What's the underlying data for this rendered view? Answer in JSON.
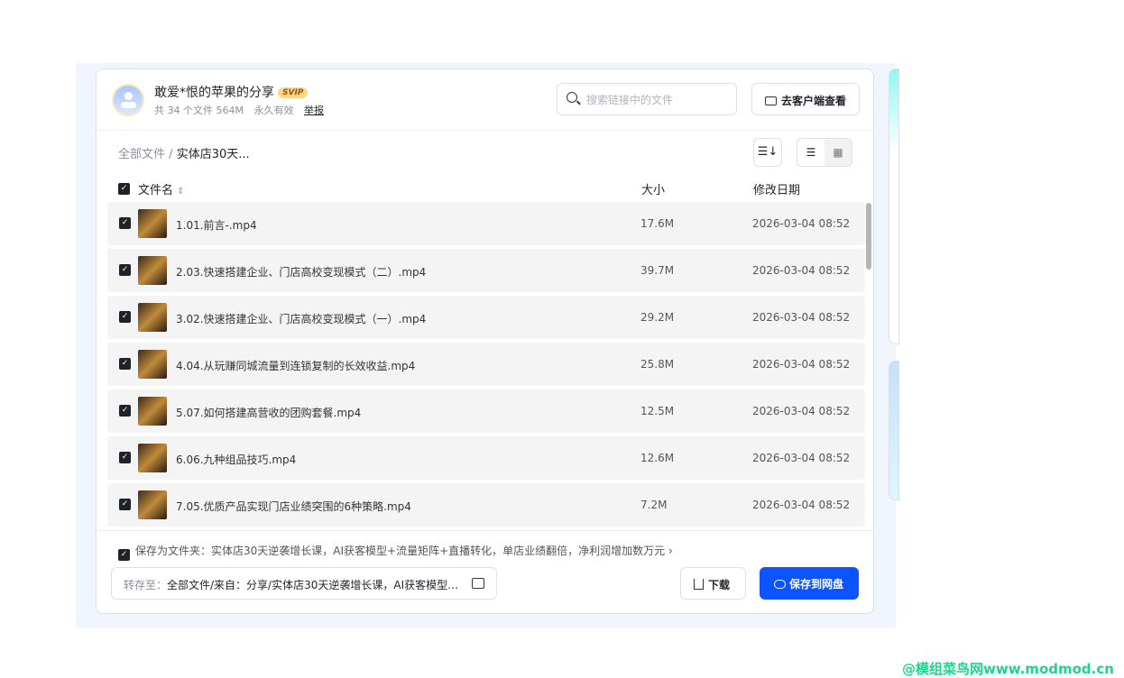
{
  "share": {
    "title": "敢爱*恨的苹果的分享",
    "badge": "SVIP",
    "file_count": "共 34 个文件 564M",
    "validity": "永久有效",
    "report": "举报"
  },
  "search": {
    "placeholder": "搜索链接中的文件"
  },
  "client_button": "去客户端查看",
  "breadcrumb": {
    "root": "全部文件",
    "sep": "/",
    "current": "实体店30天..."
  },
  "table": {
    "headers": {
      "name": "文件名",
      "sort": "⇕",
      "size": "大小",
      "date": "修改日期"
    },
    "rows": [
      {
        "name": "1.01.前言-.mp4",
        "size": "17.6M",
        "date": "2026-03-04 08:52"
      },
      {
        "name": "2.03.快速搭建企业、门店高校变现模式（二）.mp4",
        "size": "39.7M",
        "date": "2026-03-04 08:52"
      },
      {
        "name": "3.02.快速搭建企业、门店高校变现模式（一）.mp4",
        "size": "29.2M",
        "date": "2026-03-04 08:52"
      },
      {
        "name": "4.04.从玩赚同城流量到连锁复制的长效收益.mp4",
        "size": "25.8M",
        "date": "2026-03-04 08:52"
      },
      {
        "name": "5.07.如何搭建高营收的团购套餐.mp4",
        "size": "12.5M",
        "date": "2026-03-04 08:52"
      },
      {
        "name": "6.06.九种组品技巧.mp4",
        "size": "12.6M",
        "date": "2026-03-04 08:52"
      },
      {
        "name": "7.05.优质产品实现门店业绩突围的6种策略.mp4",
        "size": "7.2M",
        "date": "2026-03-04 08:52"
      }
    ]
  },
  "save_folder": "保存为文件夹：实体店30天逆袭增长课，AI获客模型+流量矩阵+直播转化，单店业绩翻倍，净利润增加数万元 ›",
  "destination": {
    "label": "转存至：",
    "value": "全部文件/来自：分享/实体店30天逆袭增长课，AI获客模型…"
  },
  "download_button": "下载",
  "save_button": "保存到网盘",
  "watermark": "@模组菜鸟网www.modmod.cn",
  "colors": {
    "primary": "#0d53ff",
    "background": "#f1f5fe"
  }
}
